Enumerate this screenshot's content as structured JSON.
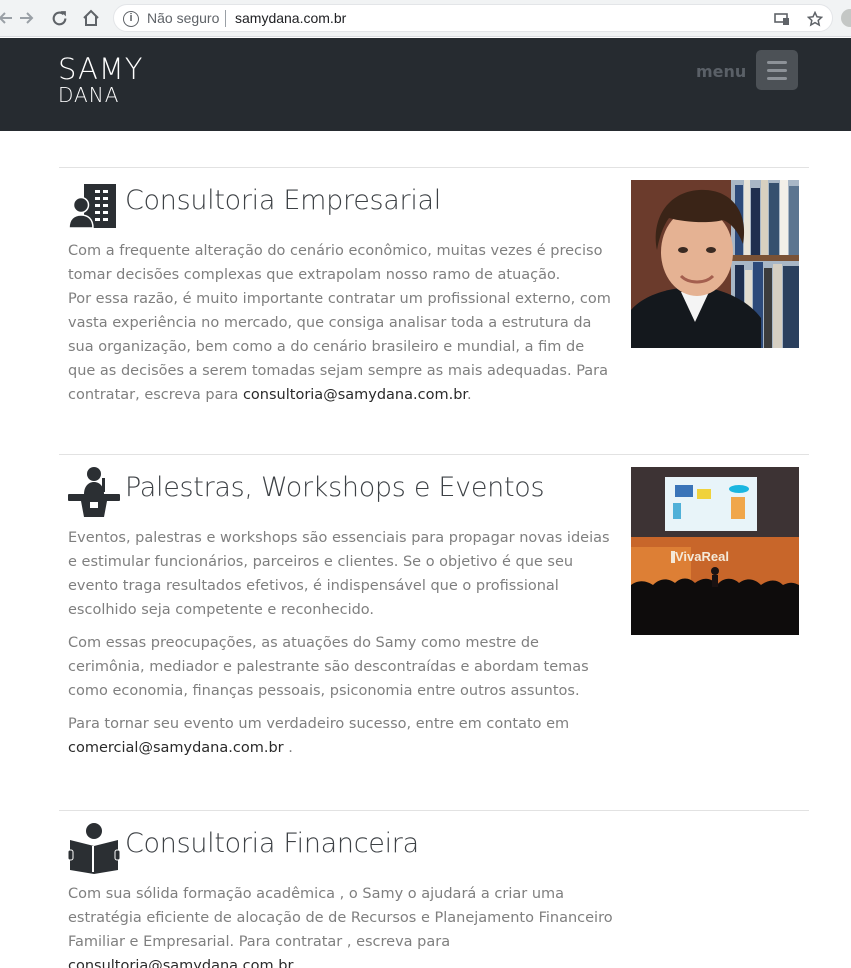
{
  "browser": {
    "security_label": "Não seguro",
    "url": "samydana.com.br"
  },
  "header": {
    "logo_line1": "SAMY",
    "logo_line2": "DANA",
    "menu_label": "menu"
  },
  "sections": [
    {
      "icon": "office-building-person-icon",
      "title": "Consultoria Empresarial",
      "paragraphs": [
        {
          "text": "Com a frequente alteração do cenário econômico, muitas vezes é preciso tomar decisões complexas que extrapolam nosso ramo de atuação."
        },
        {
          "text": "Por essa razão, é muito importante contratar um profissional externo, com vasta experiência no mercado, que consiga analisar toda a estrutura da sua organização, bem como a do cenário brasileiro e mundial, a fim de que as decisões a serem tomadas sejam sempre as mais adequadas. Para contratar, escreva para",
          "email": "consultoria@samydana.com.br",
          "after": "."
        }
      ],
      "image": "portrait-photo"
    },
    {
      "icon": "speaker-podium-icon",
      "title": "Palestras, Workshops e Eventos",
      "paragraphs": [
        {
          "text": "Eventos, palestras e workshops são essenciais para propagar novas ideias e estimular funcionários, parceiros e clientes. Se o objetivo é que seu evento traga resultados efetivos, é indispensável que o profissional escolhido seja competente e reconhecido."
        },
        {
          "text": "Com essas preocupações, as atuações do Samy como mestre de cerimônia, mediador e palestrante são descontraídas e abordam temas como economia, finanças pessoais, psiconomia entre outros assuntos."
        },
        {
          "text": "Para tornar seu evento um verdadeiro sucesso, entre em contato em",
          "email": "comercial@samydana.com.br",
          "after": " ."
        }
      ],
      "image": "event-stage-photo",
      "image_sign": "VivaReal"
    },
    {
      "icon": "person-reading-book-icon",
      "title": "Consultoria Financeira",
      "paragraphs": [
        {
          "text": "Com sua sólida formação acadêmica , o Samy o ajudará a criar uma estratégia eficiente de alocação de de Recursos e Planejamento Financeiro Familiar e Empresarial. Para contratar , escreva para",
          "email": "consultoria@samydana.com.br",
          "after": " ."
        }
      ]
    }
  ]
}
